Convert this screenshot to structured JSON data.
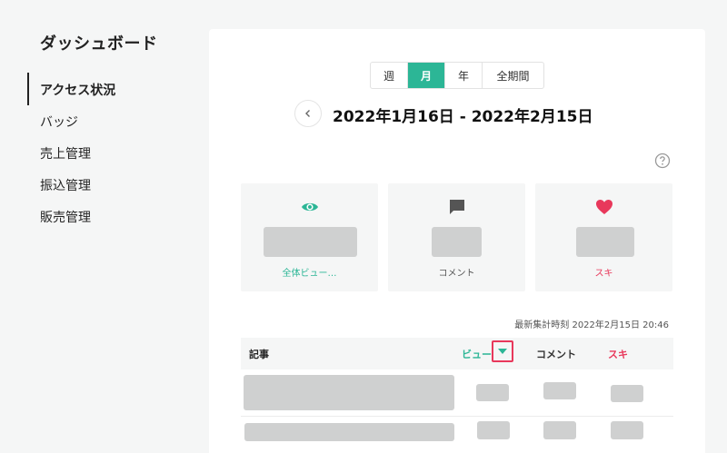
{
  "sidebar": {
    "title": "ダッシュボード",
    "items": [
      {
        "label": "アクセス状況",
        "active": true
      },
      {
        "label": "バッジ",
        "active": false
      },
      {
        "label": "売上管理",
        "active": false
      },
      {
        "label": "振込管理",
        "active": false
      },
      {
        "label": "販売管理",
        "active": false
      }
    ]
  },
  "period_tabs": [
    {
      "label": "週",
      "active": false
    },
    {
      "label": "月",
      "active": true
    },
    {
      "label": "年",
      "active": false
    },
    {
      "label": "全期間",
      "active": false
    }
  ],
  "date_range": "2022年1月16日 - 2022年2月15日",
  "cards": [
    {
      "label": "全体ビュー…",
      "icon": "eye-icon",
      "color": "#2cb696"
    },
    {
      "label": "コメント",
      "icon": "comment-icon",
      "color": "#555555"
    },
    {
      "label": "スキ",
      "icon": "heart-icon",
      "color": "#e8385b"
    }
  ],
  "last_updated": "最新集計時刻 2022年2月15日 20:46",
  "table": {
    "col_article": "記事",
    "col_views": "ビュー",
    "col_comments": "コメント",
    "col_likes": "スキ"
  },
  "colors": {
    "accent": "#2cb696",
    "like": "#e8385b",
    "highlight": "#e8385b"
  }
}
